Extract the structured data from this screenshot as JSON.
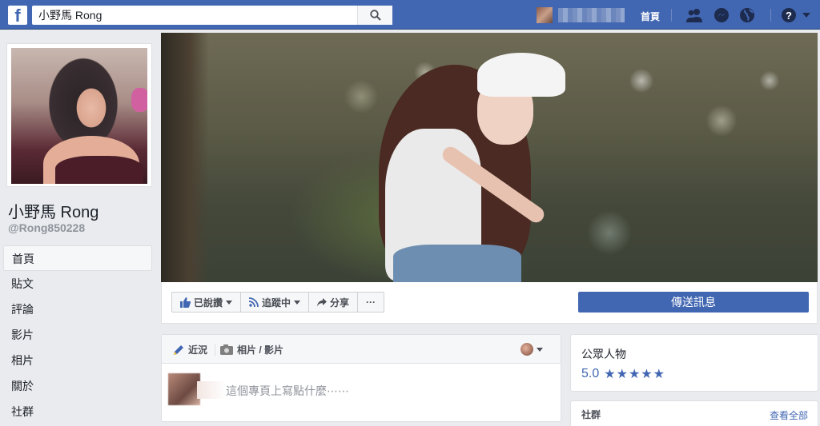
{
  "topbar": {
    "logo": "f",
    "search_value": "小野馬 Rong",
    "home_label": "首頁",
    "icons": [
      "friends-icon",
      "messenger-icon",
      "globe-icon",
      "help-icon",
      "caret-down-icon"
    ]
  },
  "profile": {
    "name": "小野馬 Rong",
    "handle": "@Rong850228"
  },
  "left_nav": {
    "items": [
      {
        "label": "首頁",
        "active": true
      },
      {
        "label": "貼文"
      },
      {
        "label": "評論"
      },
      {
        "label": "影片"
      },
      {
        "label": "相片"
      },
      {
        "label": "關於"
      },
      {
        "label": "社群"
      }
    ]
  },
  "actions": {
    "like_label": "已說讚",
    "follow_label": "追蹤中",
    "share_label": "分享",
    "more_label": "···",
    "send_message_label": "傳送訊息"
  },
  "composer": {
    "tab_post": "近況",
    "tab_photo": "相片 / 影片",
    "placeholder": "這個專頁上寫點什麼⋯⋯"
  },
  "about_box": {
    "category": "公眾人物",
    "rating_value": "5.0",
    "stars": "★★★★★"
  },
  "community_box": {
    "title": "社群",
    "see_all": "查看全部"
  },
  "colors": {
    "brand": "#4267b2",
    "background": "#e9ebee"
  }
}
